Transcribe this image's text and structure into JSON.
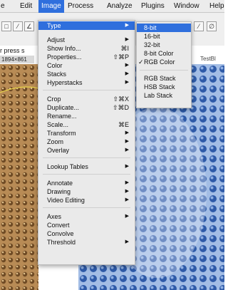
{
  "menubar": {
    "items": [
      "e",
      "Edit",
      "Image",
      "Process",
      "Analyze",
      "Plugins",
      "Window",
      "Help"
    ],
    "active": "Image"
  },
  "toolbar": {
    "status_text": "r press s",
    "tool_glyphs": [
      "□",
      "⁄",
      "∠",
      "⁄",
      "∅"
    ]
  },
  "window": {
    "size_text": "1894×861",
    "right_title": "TestBl"
  },
  "image_menu": {
    "items": [
      {
        "label": "Type",
        "shortcut": "",
        "has_submenu": true,
        "highlight": true
      },
      {
        "label": "Adjust",
        "shortcut": "",
        "has_submenu": true
      },
      {
        "label": "Show Info...",
        "shortcut": "⌘I",
        "has_submenu": false
      },
      {
        "label": "Properties...",
        "shortcut": "⇧⌘P",
        "has_submenu": false
      },
      {
        "label": "Color",
        "shortcut": "",
        "has_submenu": true
      },
      {
        "label": "Stacks",
        "shortcut": "",
        "has_submenu": true
      },
      {
        "label": "Hyperstacks",
        "shortcut": "",
        "has_submenu": true
      },
      {
        "label": "Crop",
        "shortcut": "⇧⌘X",
        "has_submenu": false
      },
      {
        "label": "Duplicate...",
        "shortcut": "⇧⌘D",
        "has_submenu": false
      },
      {
        "label": "Rename...",
        "shortcut": "",
        "has_submenu": false
      },
      {
        "label": "Scale...",
        "shortcut": "⌘E",
        "has_submenu": false
      },
      {
        "label": "Transform",
        "shortcut": "",
        "has_submenu": true
      },
      {
        "label": "Zoom",
        "shortcut": "",
        "has_submenu": true
      },
      {
        "label": "Overlay",
        "shortcut": "",
        "has_submenu": true
      },
      {
        "label": "Lookup Tables",
        "shortcut": "",
        "has_submenu": true
      },
      {
        "label": "Annotate",
        "shortcut": "",
        "has_submenu": true
      },
      {
        "label": "Drawing",
        "shortcut": "",
        "has_submenu": true
      },
      {
        "label": "Video Editing",
        "shortcut": "",
        "has_submenu": true
      },
      {
        "label": "Axes",
        "shortcut": "",
        "has_submenu": true
      },
      {
        "label": "Convert",
        "shortcut": "",
        "has_submenu": false
      },
      {
        "label": "Convolve",
        "shortcut": "",
        "has_submenu": false
      },
      {
        "label": "Threshold",
        "shortcut": "",
        "has_submenu": true
      }
    ]
  },
  "type_submenu": {
    "items": [
      {
        "label": "8-bit",
        "checked": false,
        "highlight": true
      },
      {
        "label": "16-bit",
        "checked": false
      },
      {
        "label": "32-bit",
        "checked": false
      },
      {
        "label": "8-bit Color",
        "checked": false
      },
      {
        "label": "RGB Color",
        "checked": true
      },
      {
        "label": "RGB Stack",
        "checked": false
      },
      {
        "label": "HSB Stack",
        "checked": false
      },
      {
        "label": "Lab Stack",
        "checked": false
      }
    ]
  },
  "icons": {
    "submenu_arrow": "▶",
    "check": "✓"
  },
  "colors": {
    "highlight": "#2f6fdd",
    "menu_bg": "#eaeaea"
  }
}
